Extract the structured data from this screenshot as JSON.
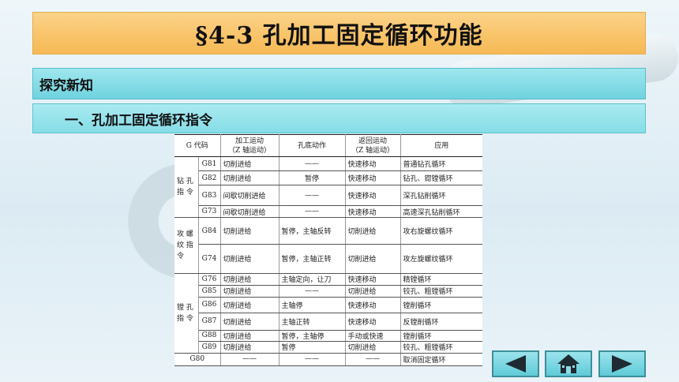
{
  "title": "§4-3  孔加工固定循环功能",
  "section": "探究新知",
  "subsection": "一、孔加工固定循环指令",
  "table": {
    "headers": {
      "gcode": "G 代码",
      "feed_line1": "加工运动",
      "feed_line2": "（Z 轴运动）",
      "bottom": "孔底动作",
      "ret_line1": "返回运动",
      "ret_line2": "（Z 轴运动）",
      "app": "应用"
    },
    "groups": [
      {
        "label_l1": "钻 孔",
        "label_l2": "指 令",
        "label_l3": ""
      },
      {
        "label_l1": "攻 螺",
        "label_l2": "纹 指",
        "label_l3": "令"
      },
      {
        "label_l1": "镗 孔",
        "label_l2": "指 令",
        "label_l3": ""
      }
    ],
    "rows": [
      {
        "g": "G81",
        "feed": "切削进给",
        "bottom": "——",
        "ret": "快速移动",
        "app": "普通钻孔循环"
      },
      {
        "g": "G82",
        "feed": "切削进给",
        "bottom": "暂停",
        "ret": "快速移动",
        "app": "钻孔、锪镗循环"
      },
      {
        "g": "G83",
        "feed": "间歇切削进给",
        "bottom": "——",
        "ret": "快速移动",
        "app": "深孔钻削循环"
      },
      {
        "g": "G73",
        "feed": "间歇切削进给",
        "bottom": "——",
        "ret": "快速移动",
        "app": "高速深孔钻削循环"
      },
      {
        "g": "G84",
        "feed": "切削进给",
        "bottom": "暂停，主轴反转",
        "ret": "切削进给",
        "app": "攻右旋螺纹循环"
      },
      {
        "g": "G74",
        "feed": "切削进给",
        "bottom": "暂停，主轴正转",
        "ret": "切削进给",
        "app": "攻左旋螺纹循环"
      },
      {
        "g": "G76",
        "feed": "切削进给",
        "bottom": "主轴定向，让刀",
        "ret": "快速移动",
        "app": "精镗循环"
      },
      {
        "g": "G85",
        "feed": "切削进给",
        "bottom": "——",
        "ret": "切削进给",
        "app": "铰孔、粗镗循环"
      },
      {
        "g": "G86",
        "feed": "切削进给",
        "bottom": "主轴停",
        "ret": "快速移动",
        "app": "镗削循环"
      },
      {
        "g": "G87",
        "feed": "切削进给",
        "bottom": "主轴正转",
        "ret": "快速移动",
        "app": "反镗削循环"
      },
      {
        "g": "G88",
        "feed": "切削进给",
        "bottom": "暂停，主轴停",
        "ret": "手动或快速",
        "app": "镗削循环"
      },
      {
        "g": "G89",
        "feed": "切削进给",
        "bottom": "暂停",
        "ret": "切削进给",
        "app": "铰孔、粗镗循环"
      },
      {
        "g": "G80",
        "feed": "——",
        "bottom": "——",
        "ret": "——",
        "app": "取消固定循环"
      }
    ]
  },
  "nav": {
    "prev_icon": "triangle-left-icon",
    "home_icon": "house-icon",
    "next_icon": "triangle-right-icon"
  },
  "colors": {
    "title_bg": "#f9c46a",
    "section_bg": "#6fd3df",
    "nav_bg": "#5fcbd8",
    "nav_glyph": "#1f2a33"
  }
}
